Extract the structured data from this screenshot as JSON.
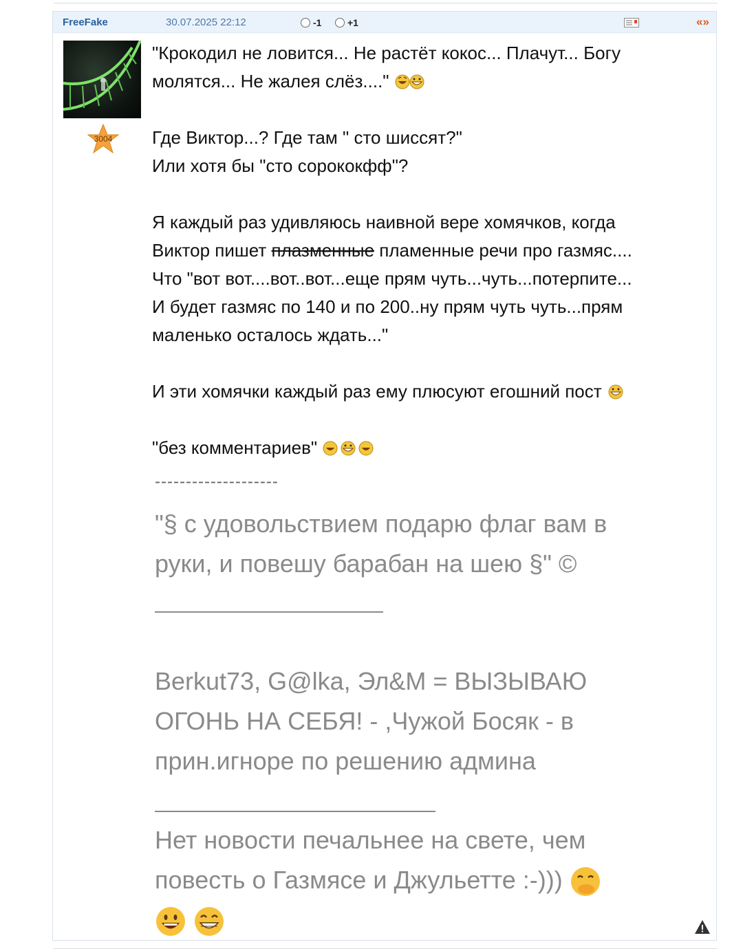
{
  "post": {
    "author": "FreeFake",
    "date": "30.07.2025 22:12",
    "vote_minus": "-1",
    "vote_plus": "+1",
    "quote_symbol": "«»",
    "rating": "3004",
    "icons": {
      "message": "message-icon",
      "quote": "quote-icon",
      "report": "warning-icon",
      "avatar": "avatar-image",
      "rating_star": "star-icon"
    },
    "body": {
      "l1": "\"Крокодил не ловится... Не растёт кокос... Плачут... Богу",
      "l2": "молятся... Не жалея слёз....\"",
      "l3": "Где Виктор...? Где там \" сто шиссят?\"",
      "l4": "Или хотя бы \"сто сорококфф\"?",
      "l5": "Я каждый раз удивляюсь наивной вере хомячков, когда",
      "l6a": "Виктор пишет ",
      "l6_strike": "плазменные",
      "l6b": " пламенные речи про газмяс....",
      "l7": "Что \"вот вот....вот..вот...еще прям чуть...чуть...потерпите...",
      "l8": "И будет газмяс по 140 и по 200..ну прям чуть чуть...прям",
      "l9": "маленько осталось ждать...\"",
      "l10": "И эти хомячки каждый раз ему плюсуют егошний пост",
      "l11": "\"без комментариев\""
    },
    "signature": {
      "dashes": "--------------------",
      "quote_l1": "\"§ с удовольствием подарю флаг вам в",
      "quote_l2": "руки, и повешу барабан на шею §\" ©",
      "names_l1": "Berkut73, G@lka, Эл&M = ВЫЗЫВАЮ",
      "names_l2": "ОГОНЬ НА СЕБЯ! - ,Чужой Босяк - в",
      "names_l3": "прин.игноре по решению админа",
      "romeo_l1": "Нет новости печальнее на свете, чем",
      "romeo_l2": "повесть о Газмясе и Джульетте :-)))"
    },
    "colors": {
      "header_bg": "#eaf3fc",
      "author": "#2a5f9c",
      "date": "#4f79a8",
      "quote_icon": "#e05a1c",
      "signature_text": "#8a8a8a"
    }
  }
}
